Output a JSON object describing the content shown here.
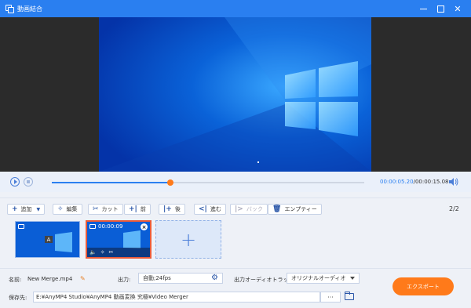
{
  "window": {
    "title": "動画結合"
  },
  "player": {
    "current_time": "00:00:05.20",
    "separator": "/",
    "total_time": "00:00:15.08",
    "progress": 0.38
  },
  "toolbar": {
    "add": "追加",
    "edit": "編集",
    "cut": "カット",
    "front": "前",
    "back": "後",
    "forward": "進む",
    "backward": "バック",
    "empty": "エンプティー"
  },
  "pager": {
    "text": "2/2"
  },
  "clips": [
    {
      "badge": "A"
    },
    {
      "timecode": "00:00:09"
    }
  ],
  "output": {
    "name_label": "名前:",
    "name_value": "New Merge.mp4",
    "output_label": "出力:",
    "output_value": "自動;24fps",
    "audio_label": "出力オーディオトラック:",
    "audio_value": "オリジナルオーディオ",
    "save_label": "保存先:",
    "save_path": "E:¥AnyMP4 Studio¥AnyMP4 動画変換 究極¥Video Merger",
    "browse": "···",
    "export": "エクスポート"
  },
  "colors": {
    "accent": "#2a7ff0",
    "export": "#ff7a1a",
    "selected_clip": "#e85b3a"
  }
}
